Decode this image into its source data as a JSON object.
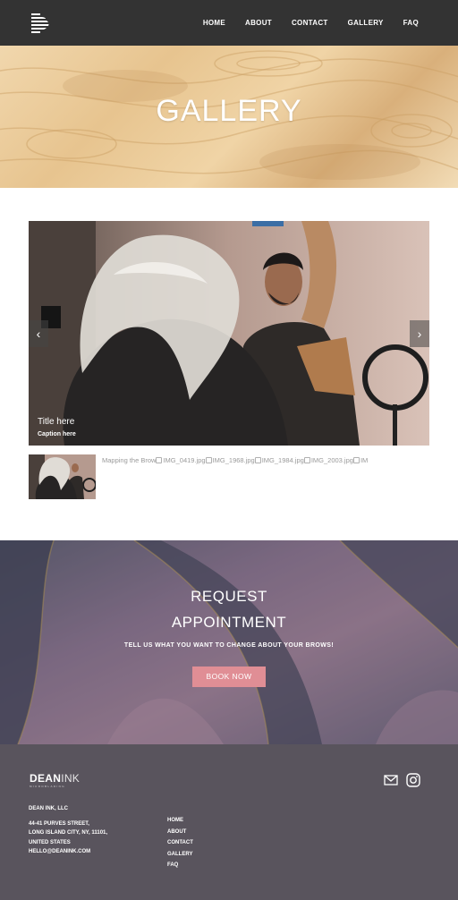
{
  "header": {
    "logo_icon": "d-logo-icon",
    "nav": [
      {
        "label": "HOME"
      },
      {
        "label": "ABOUT"
      },
      {
        "label": "CONTACT"
      },
      {
        "label": "GALLERY"
      },
      {
        "label": "FAQ"
      }
    ]
  },
  "hero": {
    "title": "GALLERY"
  },
  "gallery": {
    "slide": {
      "title": "Title here",
      "caption": "Caption here"
    },
    "prev_icon": "chevron-left-icon",
    "next_icon": "chevron-right-icon",
    "thumbnails": [
      "Mapping the Brow",
      "IMG_0419.jpg",
      "IMG_1968.jpg",
      "IMG_1984.jpg",
      "IMG_2003.jpg",
      "IM"
    ]
  },
  "cta": {
    "line1": "REQUEST",
    "line2": "APPOINTMENT",
    "subtitle": "TELL US WHAT YOU WANT TO CHANGE ABOUT YOUR BROWS!",
    "button": "BOOK NOW",
    "button_color": "#e08e95"
  },
  "footer": {
    "logo_bold": "DEAN",
    "logo_light": "INK",
    "logo_sub": "MICROBLADING",
    "company": "DEAN INK, LLC",
    "address1": "44-41 PURVES STREET,",
    "address2": "LONG ISLAND CITY, NY, 11101,",
    "address3": "UNITED STATES",
    "email": "HELLO@DEANINK.COM",
    "nav": [
      {
        "label": "HOME"
      },
      {
        "label": "ABOUT"
      },
      {
        "label": "CONTACT"
      },
      {
        "label": "GALLERY"
      },
      {
        "label": "FAQ"
      }
    ],
    "icons": [
      "mail-icon",
      "instagram-icon"
    ],
    "background": "#59545d"
  },
  "colors": {
    "header_bg": "#333333",
    "accent": "#e08e95"
  }
}
